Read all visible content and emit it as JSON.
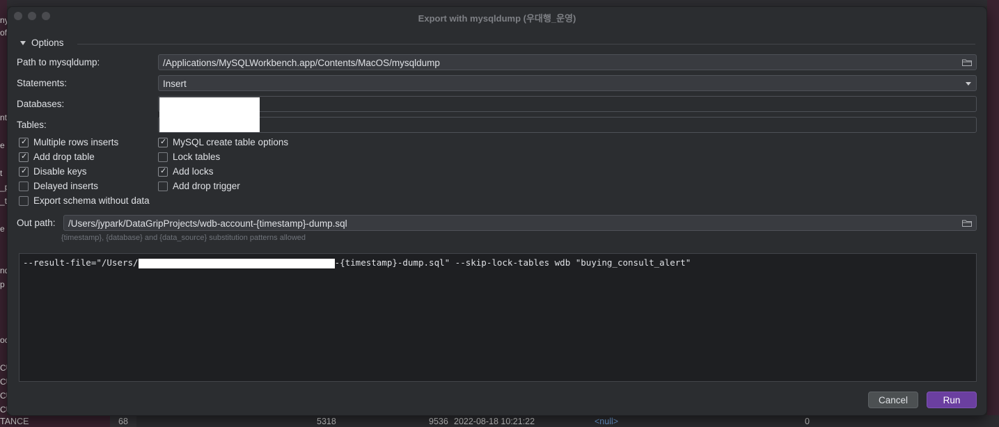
{
  "background": {
    "left_fragments": [
      "ny",
      "of",
      "nt",
      "e",
      "t",
      "_p",
      "_t",
      "e",
      "nd",
      "p",
      "oc",
      "CU",
      "CU",
      "CU",
      "CU",
      "TANCE"
    ],
    "bottom_row": {
      "id": "68",
      "value1": "5318",
      "value2": "9536",
      "datetime": "2022-08-18 10:21:22",
      "null_text": "<null>",
      "last": "0"
    }
  },
  "dialog": {
    "title": "Export with mysqldump (우대행_운영)",
    "section_label": "Options",
    "path_label": "Path to mysqldump:",
    "path_value": "/Applications/MySQLWorkbench.app/Contents/MacOS/mysqldump",
    "statements_label": "Statements:",
    "statements_value": "Insert",
    "databases_label": "Databases:",
    "tables_label": "Tables:",
    "checkboxes_left": [
      {
        "label": "Multiple rows inserts",
        "checked": true
      },
      {
        "label": "Add drop table",
        "checked": true
      },
      {
        "label": "Disable keys",
        "checked": true
      },
      {
        "label": "Delayed inserts",
        "checked": false
      },
      {
        "label": "Export schema without data",
        "checked": false
      }
    ],
    "checkboxes_right": [
      {
        "label": "MySQL create table options",
        "checked": true
      },
      {
        "label": "Lock tables",
        "checked": false
      },
      {
        "label": "Add locks",
        "checked": true
      },
      {
        "label": "Add drop trigger",
        "checked": false
      }
    ],
    "out_path_label": "Out path:",
    "out_path_value": "/Users/jypark/DataGripProjects/wdb-account-{timestamp}-dump.sql",
    "hint": "{timestamp}, {database} and {data_source} substitution patterns allowed",
    "command_prefix": "--result-file=\"/Users/",
    "command_suffix": "-{timestamp}-dump.sql\" --skip-lock-tables wdb \"buying_consult_alert\"",
    "cancel_label": "Cancel",
    "run_label": "Run"
  },
  "colors": {
    "run_button": "#6b3fa0",
    "dialog_bg": "#2b2d30"
  }
}
